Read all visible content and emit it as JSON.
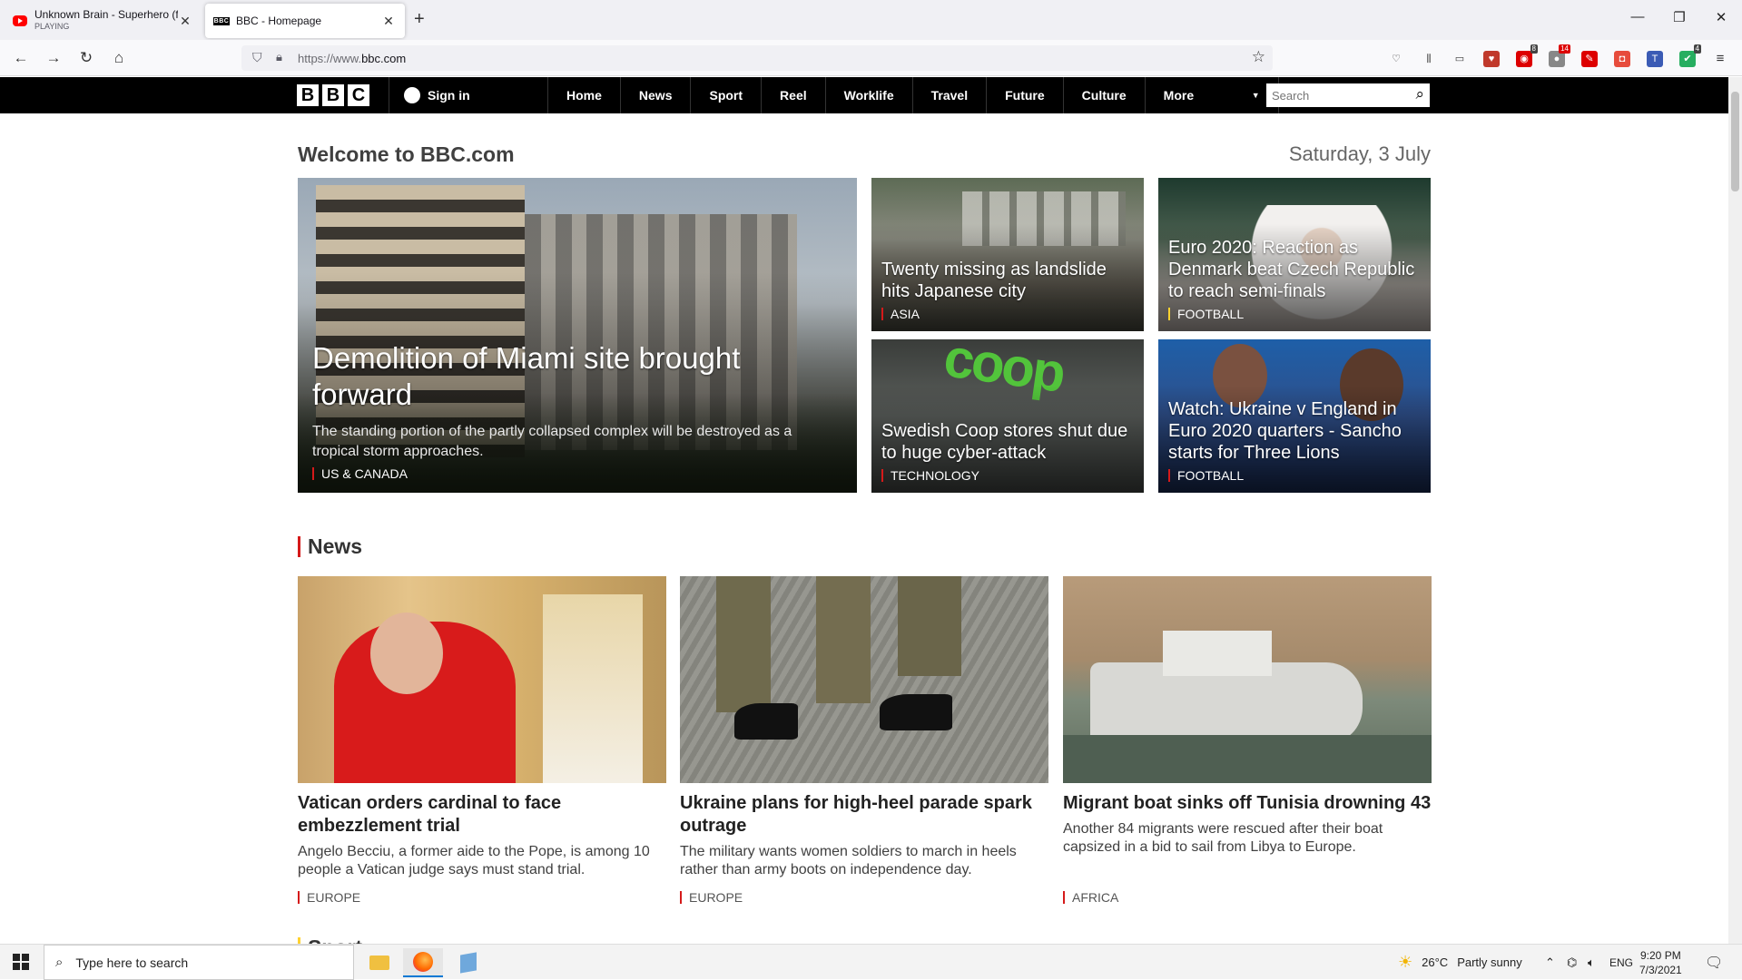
{
  "browser": {
    "tabs": [
      {
        "title": "Unknown Brain - Superhero (fe",
        "subtitle": "PLAYING",
        "icon": "youtube-icon"
      },
      {
        "title": "BBC - Homepage",
        "icon": "bbc-icon"
      }
    ],
    "url_prefix": "https://www.",
    "url_domain": "bbc.com",
    "extension_badges": {
      "ext1": "8",
      "ext2": "14",
      "ext3": "4"
    }
  },
  "bbc": {
    "logo": [
      "B",
      "B",
      "C"
    ],
    "signin": "Sign in",
    "nav": [
      "Home",
      "News",
      "Sport",
      "Reel",
      "Worklife",
      "Travel",
      "Future",
      "Culture",
      "More"
    ],
    "search_placeholder": "Search",
    "welcome": "Welcome to BBC.com",
    "date": "Saturday, 3 July",
    "hero": {
      "main": {
        "title": "Demolition of Miami site brought forward",
        "desc": "The standing portion of the partly collapsed complex will be destroyed as a tropical storm approaches.",
        "tag": "US & CANADA"
      },
      "s1": {
        "title": "Twenty missing as landslide hits Japanese city",
        "tag": "ASIA"
      },
      "s2": {
        "title": "Euro 2020: Reaction as Denmark beat Czech Republic to reach semi-finals",
        "tag": "FOOTBALL"
      },
      "s3": {
        "title": "Swedish Coop stores shut due to huge cyber-attack",
        "tag": "TECHNOLOGY",
        "sign": "coop"
      },
      "s4": {
        "title": "Watch: Ukraine v England in Euro 2020 quarters - Sancho starts for Three Lions",
        "tag": "FOOTBALL"
      }
    },
    "news_title": "News",
    "news": [
      {
        "title": "Vatican orders cardinal to face embezzlement trial",
        "desc": "Angelo Becciu, a former aide to the Pope, is among 10 people a Vatican judge says must stand trial.",
        "tag": "EUROPE"
      },
      {
        "title": "Ukraine plans for high-heel parade spark outrage",
        "desc": "The military wants women soldiers to march in heels rather than army boots on independence day.",
        "tag": "EUROPE"
      },
      {
        "title": "Migrant boat sinks off Tunisia drowning 43",
        "desc": "Another 84 migrants were rescued after their boat capsized in a bid to sail from Libya to Europe.",
        "tag": "AFRICA"
      }
    ],
    "next_section": "Sport"
  },
  "taskbar": {
    "search_placeholder": "Type here to search",
    "weather_temp": "26°C",
    "weather_desc": "Partly sunny",
    "lang": "ENG",
    "time": "9:20 PM",
    "date": "7/3/2021"
  },
  "colors": {
    "accent_red": "#d51a1a",
    "sport_yellow": "#ffd230",
    "bbc_black": "#000000"
  }
}
